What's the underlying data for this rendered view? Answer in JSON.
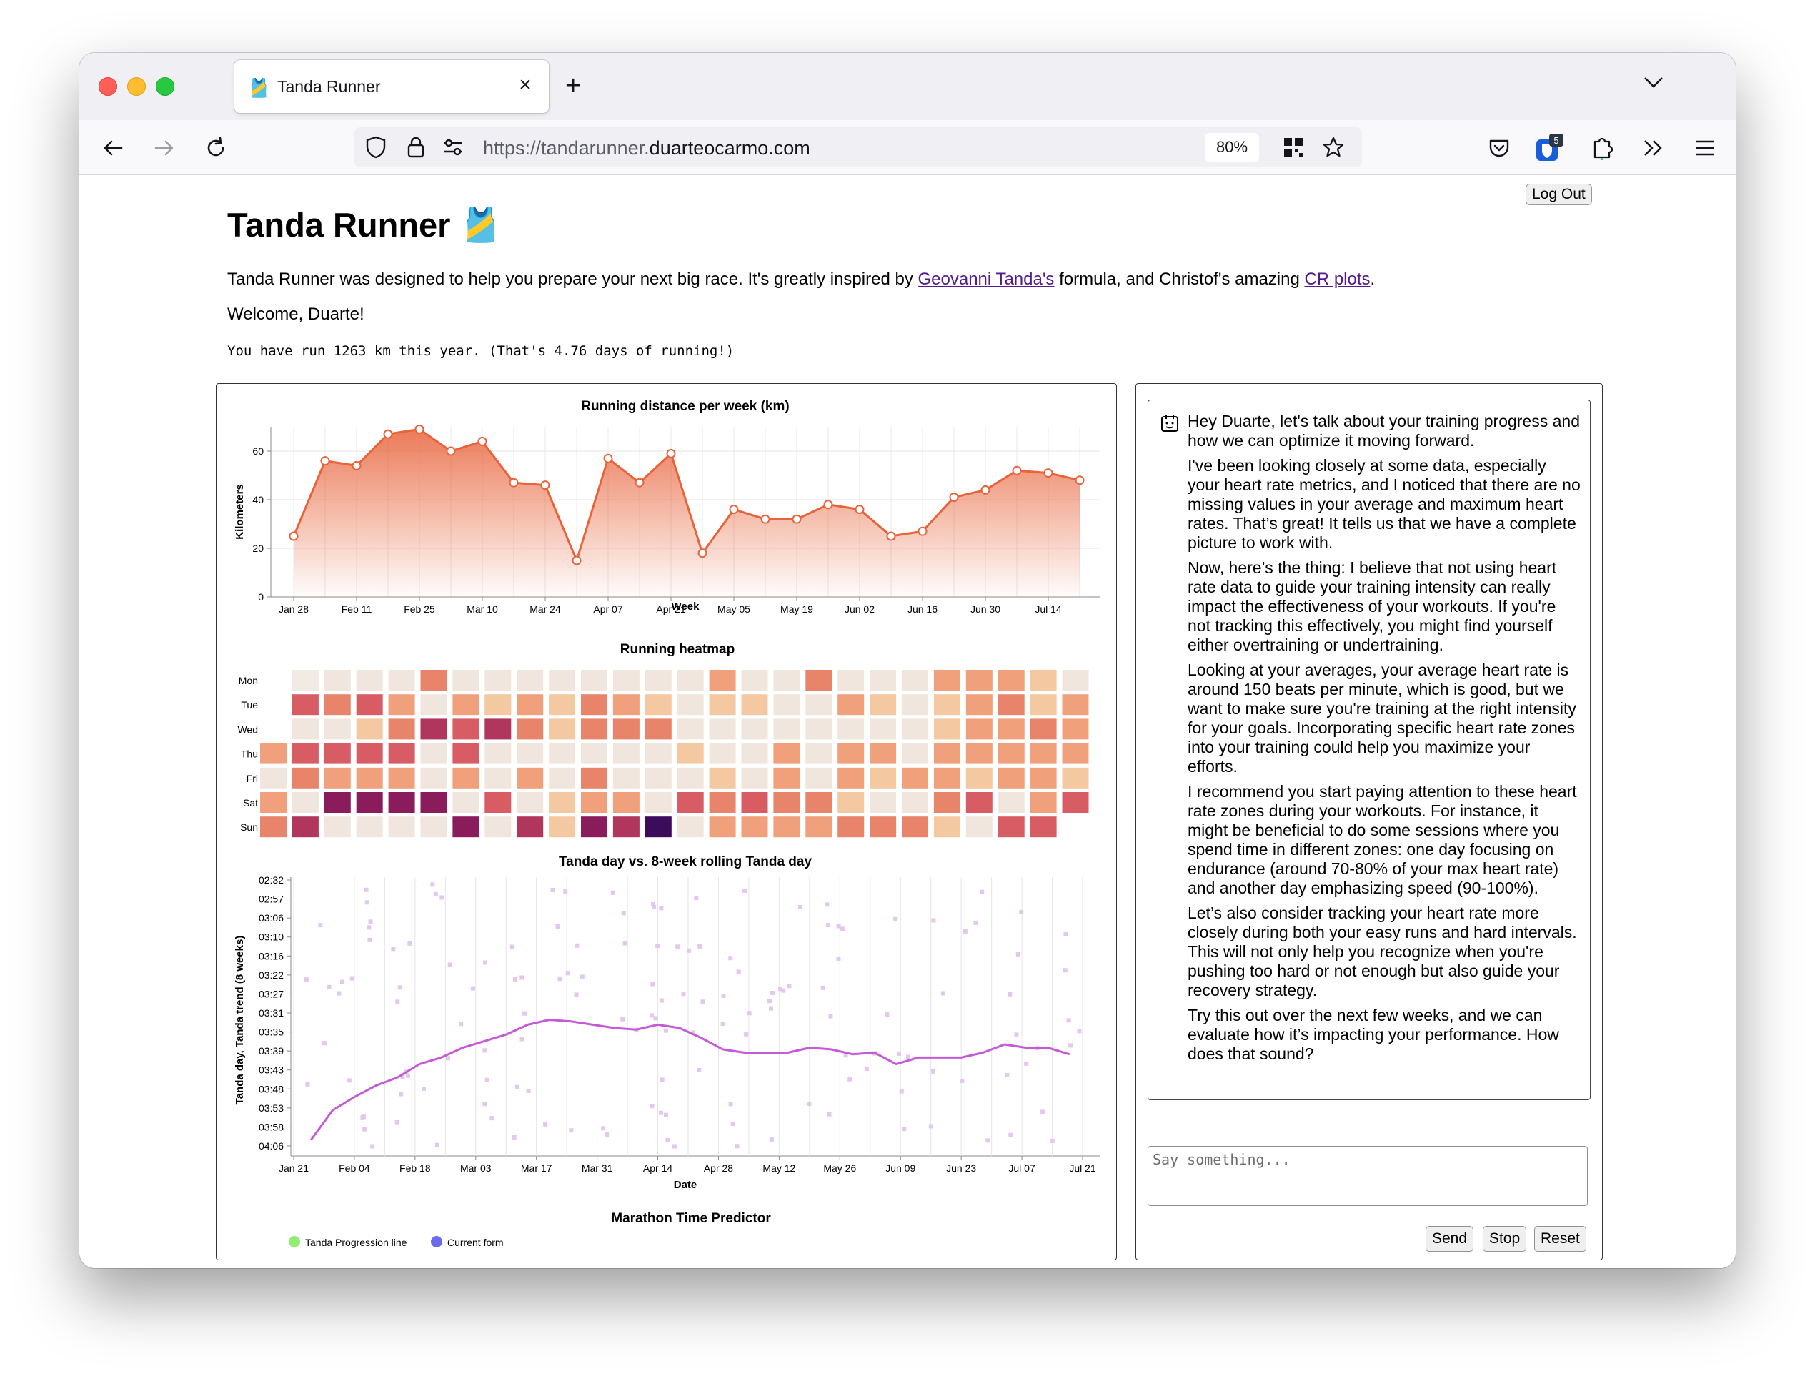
{
  "browser": {
    "tab_title": "Tanda Runner",
    "tab_favicon": "🎽",
    "url_prefix": "https://tandarunner.",
    "url_domain": "duarteocarmo.com",
    "zoom": "80%",
    "extension_badge": "5"
  },
  "page": {
    "logout_label": "Log Out",
    "title": "Tanda Runner 🎽",
    "intro_before": "Tanda Runner was designed to help you prepare your next big race. It's greatly inspired by ",
    "intro_link1": "Geovanni Tanda's",
    "intro_middle": " formula, and Christof's amazing ",
    "intro_link2": "CR plots",
    "intro_after": ".",
    "welcome": "Welcome, Duarte!",
    "stats": "You have run 1263 km this year. (That's 4.76 days of running!)"
  },
  "chat": {
    "messages": [
      "Hey Duarte, let's talk about your training progress and how we can optimize it moving forward.",
      "I've been looking closely at some data, especially your heart rate metrics, and I noticed that there are no missing values in your average and maximum heart rates. That’s great! It tells us that we have a complete picture to work with.",
      "Now, here’s the thing: I believe that not using heart rate data to guide your training intensity can really impact the effectiveness of your workouts. If you're not tracking this effectively, you might find yourself either overtraining or undertraining.",
      "Looking at your averages, your average heart rate is around 150 beats per minute, which is good, but we want to make sure you're training at the right intensity for your goals. Incorporating specific heart rate zones into your training could help you maximize your efforts.",
      "I recommend you start paying attention to these heart rate zones during your workouts. For instance, it might be beneficial to do some sessions where you spend time in different zones: one day focusing on endurance (around 70-80% of your max heart rate) and another day emphasizing speed (90-100%).",
      "Let’s also consider tracking your heart rate more closely during both your easy runs and hard intervals. This will not only help you recognize when you're pushing too hard or not enough but also guide your recovery strategy.",
      "Try this out over the next few weeks, and we can evaluate how it’s impacting your performance. How does that sound?"
    ],
    "input_placeholder": "Say something...",
    "send_label": "Send",
    "stop_label": "Stop",
    "reset_label": "Reset"
  },
  "colors": {
    "line": "#e8633a",
    "trend": "#c55ad9",
    "scatter": "#e3c7ef",
    "progression": "#90ee70",
    "current_form": "#6b6bf0"
  },
  "chart_data": [
    {
      "type": "area",
      "title": "Running distance per week (km)",
      "xlabel": "Week",
      "ylabel": "Kilometers",
      "ylim": [
        0,
        70
      ],
      "yticks": [
        0,
        20,
        40,
        60
      ],
      "xticks": [
        "Jan 28",
        "Feb 11",
        "Feb 25",
        "Mar 10",
        "Mar 24",
        "Apr 07",
        "Apr 21",
        "May 05",
        "May 19",
        "Jun 02",
        "Jun 16",
        "Jun 30",
        "Jul 14"
      ],
      "x": [
        "Jan 28",
        "Feb 04",
        "Feb 11",
        "Feb 18",
        "Feb 25",
        "Mar 03",
        "Mar 10",
        "Mar 17",
        "Mar 24",
        "Mar 31",
        "Apr 07",
        "Apr 14",
        "Apr 21",
        "Apr 28",
        "May 05",
        "May 12",
        "May 19",
        "May 26",
        "Jun 02",
        "Jun 09",
        "Jun 16",
        "Jun 23",
        "Jun 30",
        "Jul 07",
        "Jul 14",
        "Jul 21"
      ],
      "values": [
        25,
        56,
        54,
        67,
        69,
        60,
        64,
        47,
        46,
        15,
        57,
        47,
        59,
        18,
        36,
        32,
        32,
        38,
        36,
        25,
        27,
        41,
        44,
        52,
        51,
        48
      ],
      "grid": true
    },
    {
      "type": "heatmap",
      "title": "Running heatmap",
      "rows": [
        "Mon",
        "Tue",
        "Wed",
        "Thu",
        "Fri",
        "Sat",
        "Sun"
      ],
      "columns": 27,
      "levels": [
        [
          null,
          0,
          1,
          1,
          1,
          4,
          1,
          1,
          1,
          1,
          1,
          1,
          1,
          1,
          3,
          1,
          1,
          4,
          1,
          1,
          1,
          3,
          3,
          3,
          2,
          1,
          null
        ],
        [
          null,
          5,
          4,
          5,
          3,
          1,
          3,
          2,
          3,
          2,
          4,
          3,
          2,
          1,
          2,
          2,
          1,
          1,
          3,
          2,
          1,
          2,
          3,
          4,
          2,
          3,
          null
        ],
        [
          null,
          1,
          1,
          2,
          4,
          6,
          5,
          6,
          4,
          2,
          4,
          4,
          4,
          1,
          1,
          1,
          1,
          1,
          1,
          1,
          1,
          2,
          3,
          3,
          4,
          3,
          null
        ],
        [
          3,
          5,
          5,
          5,
          5,
          1,
          5,
          1,
          1,
          1,
          1,
          1,
          1,
          2,
          1,
          1,
          3,
          1,
          3,
          3,
          1,
          3,
          3,
          3,
          3,
          3,
          null
        ],
        [
          1,
          4,
          3,
          3,
          3,
          1,
          3,
          1,
          3,
          1,
          4,
          1,
          1,
          1,
          2,
          1,
          3,
          1,
          3,
          2,
          3,
          3,
          2,
          3,
          3,
          2,
          null
        ],
        [
          3,
          1,
          7,
          7,
          7,
          7,
          1,
          5,
          1,
          2,
          3,
          3,
          1,
          5,
          4,
          5,
          4,
          4,
          2,
          1,
          1,
          4,
          5,
          1,
          3,
          5,
          null
        ],
        [
          4,
          6,
          1,
          1,
          1,
          1,
          7,
          1,
          6,
          2,
          7,
          6,
          8,
          1,
          3,
          3,
          3,
          3,
          4,
          4,
          4,
          2,
          1,
          5,
          5,
          null,
          null
        ]
      ]
    },
    {
      "type": "line",
      "title": "Tanda day vs. 8-week rolling Tanda day",
      "xlabel": "Date",
      "ylabel": "Tanda day, Tanda trend (8 weeks)",
      "ytick_labels": [
        "02:32",
        "02:57",
        "03:06",
        "03:10",
        "03:16",
        "03:22",
        "03:27",
        "03:31",
        "03:35",
        "03:39",
        "03:43",
        "03:48",
        "03:53",
        "03:58",
        "04:06"
      ],
      "xticks": [
        "Jan 21",
        "Feb 04",
        "Feb 18",
        "Mar 03",
        "Mar 17",
        "Mar 31",
        "Apr 14",
        "Apr 28",
        "May 12",
        "May 26",
        "Jun 09",
        "Jun 23",
        "Jul 07",
        "Jul 21"
      ],
      "series": [
        {
          "name": "Tanda trend (8 weeks)",
          "x": [
            "Jan 25",
            "Jan 30",
            "Feb 04",
            "Feb 09",
            "Feb 14",
            "Feb 19",
            "Feb 24",
            "Mar 01",
            "Mar 06",
            "Mar 11",
            "Mar 16",
            "Mar 21",
            "Mar 26",
            "Mar 31",
            "Apr 05",
            "Apr 10",
            "Apr 15",
            "Apr 20",
            "Apr 25",
            "Apr 30",
            "May 05",
            "May 10",
            "May 15",
            "May 20",
            "May 25",
            "May 30",
            "Jun 04",
            "Jun 09",
            "Jun 14",
            "Jun 19",
            "Jun 24",
            "Jun 29",
            "Jul 04",
            "Jul 09",
            "Jul 14",
            "Jul 19"
          ],
          "y": [
            4.08,
            3.9,
            3.82,
            3.75,
            3.7,
            3.62,
            3.58,
            3.52,
            3.48,
            3.44,
            3.38,
            3.35,
            3.36,
            3.38,
            3.4,
            3.41,
            3.38,
            3.4,
            3.46,
            3.53,
            3.55,
            3.55,
            3.55,
            3.52,
            3.53,
            3.56,
            3.55,
            3.62,
            3.58,
            3.58,
            3.58,
            3.55,
            3.5,
            3.52,
            3.52,
            3.56
          ]
        }
      ]
    },
    {
      "type": "scatter",
      "title": "Marathon Time Predictor",
      "legend": [
        "Tanda Progression line",
        "Current form"
      ],
      "legend_position": "top-left"
    }
  ]
}
